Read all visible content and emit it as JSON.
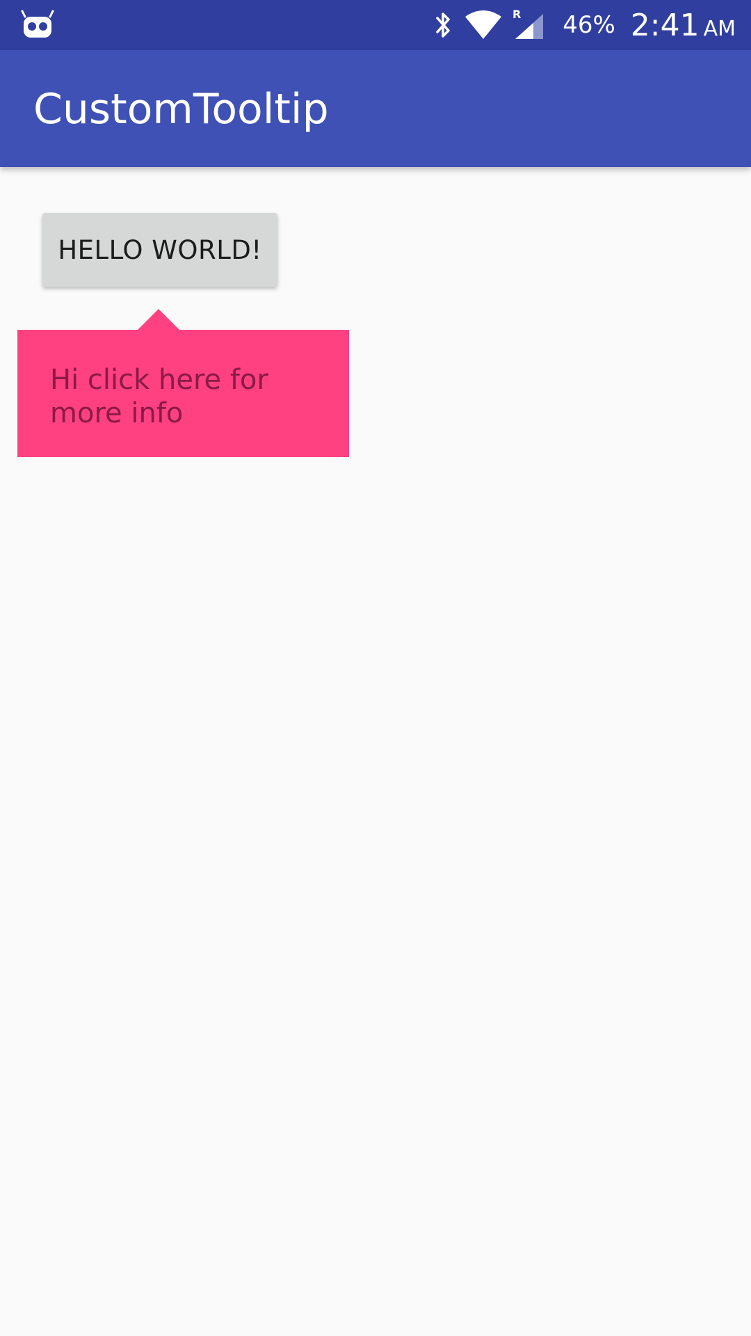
{
  "status_bar": {
    "battery": "46%",
    "time": "2:41",
    "ampm": "AM",
    "icons": [
      "android-debug-icon",
      "bluetooth-icon",
      "wifi-icon",
      "signal-icon"
    ]
  },
  "app_bar": {
    "title": "CustomTooltip"
  },
  "main": {
    "button_label": "HELLO WORLD!",
    "tooltip_text": "Hi click here for more info"
  },
  "colors": {
    "status_bar": "#303f9f",
    "app_bar": "#3f51b5",
    "background": "#fafafa",
    "button": "#d6d7d7",
    "tooltip": "#ff4081",
    "tooltip_text": "#8a1b45"
  }
}
